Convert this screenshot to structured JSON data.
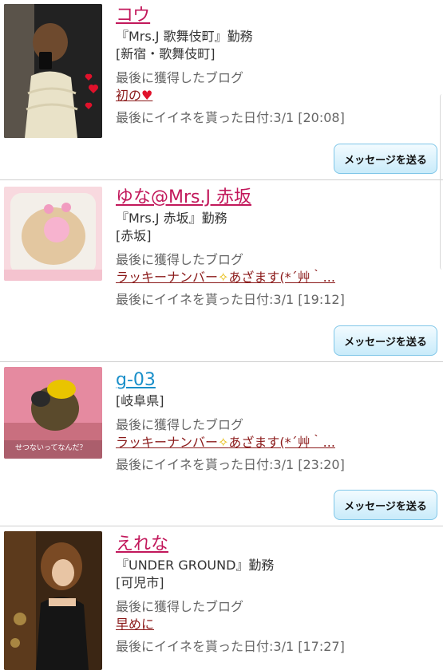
{
  "profiles": [
    {
      "name": "コウ",
      "shop": "『Mrs.J 歌舞伎町』勤務",
      "area": "[新宿・歌舞伎町]",
      "blog_label": "最後に獲得したブログ",
      "blog_text": "初の",
      "blog_heart": "♥",
      "like_date": "最後にイイネを貰った日付:3/1 [20:08]",
      "button": "メッセージを送る"
    },
    {
      "name": "ゆな@Mrs.J 赤坂",
      "shop": "『Mrs.J 赤坂』勤務",
      "area": "[赤坂]",
      "blog_label": "最後に獲得したブログ",
      "blog_pre": "ラッキーナンバー",
      "blog_sparkle": "✧",
      "blog_post": "あざます(*´艸｀...",
      "like_date": "最後にイイネを貰った日付:3/1 [19:12]",
      "button": "メッセージを送る"
    },
    {
      "name": "g-03",
      "area": "[岐阜県]",
      "photo_caption": "せつないってなんだ？",
      "blog_label": "最後に獲得したブログ",
      "blog_pre": "ラッキーナンバー",
      "blog_sparkle": "✧",
      "blog_post": "あざます(*´艸｀...",
      "like_date": "最後にイイネを貰った日付:3/1 [23:20]",
      "button": "メッセージを送る"
    },
    {
      "name": "えれな",
      "shop": "『UNDER GROUND』勤務",
      "area": "[可児市]",
      "blog_label": "最後に獲得したブログ",
      "blog_text": "早めに",
      "like_date": "最後にイイネを貰った日付:3/1 [17:27]"
    }
  ],
  "colors": {
    "name_pink": "#c2185b",
    "name_blue": "#1a8fc9",
    "blog_link": "#8b1a1a",
    "button_border": "#7fc6e8"
  }
}
